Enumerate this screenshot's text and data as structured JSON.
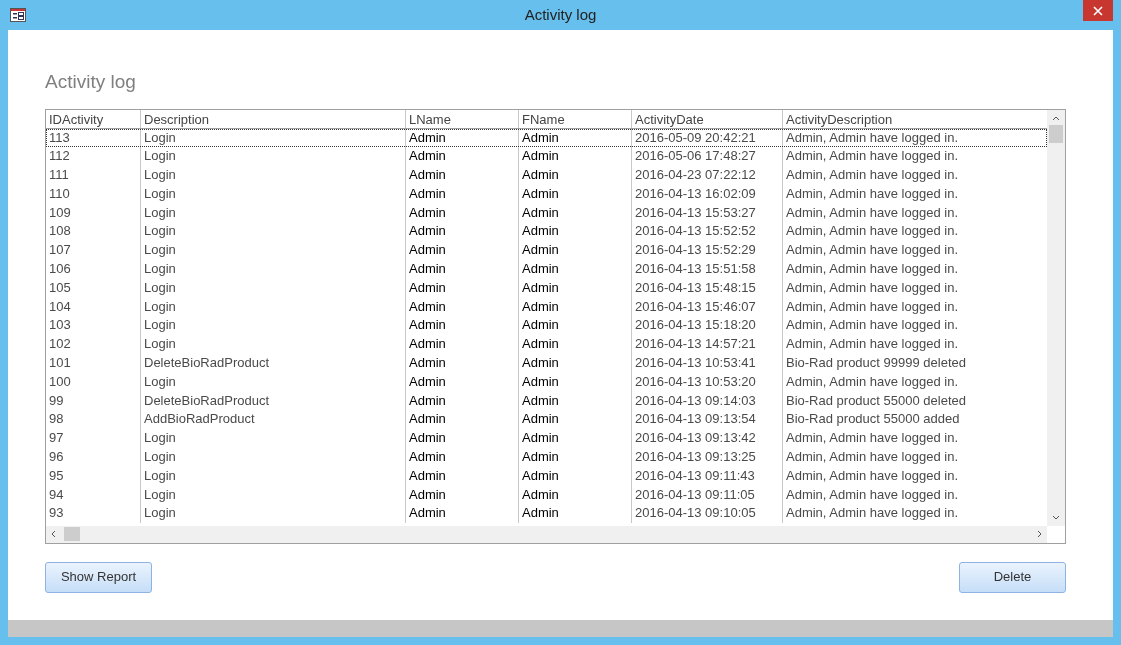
{
  "window": {
    "title": "Activity log"
  },
  "form": {
    "heading": "Activity log"
  },
  "table": {
    "columns": [
      "IDActivity",
      "Description",
      "LName",
      "FName",
      "ActivityDate",
      "ActivityDescription"
    ],
    "rows": [
      {
        "cells": [
          "113",
          "Login",
          "Admin",
          "Admin",
          "2016-05-09 20:42:21",
          "Admin, Admin have logged in."
        ],
        "selected": true
      },
      {
        "cells": [
          "112",
          "Login",
          "Admin",
          "Admin",
          "2016-05-06 17:48:27",
          "Admin, Admin have logged in."
        ],
        "selected": false
      },
      {
        "cells": [
          "111",
          "Login",
          "Admin",
          "Admin",
          "2016-04-23 07:22:12",
          "Admin, Admin have logged in."
        ],
        "selected": false
      },
      {
        "cells": [
          "110",
          "Login",
          "Admin",
          "Admin",
          "2016-04-13 16:02:09",
          "Admin, Admin have logged in."
        ],
        "selected": false
      },
      {
        "cells": [
          "109",
          "Login",
          "Admin",
          "Admin",
          "2016-04-13 15:53:27",
          "Admin, Admin have logged in."
        ],
        "selected": false
      },
      {
        "cells": [
          "108",
          "Login",
          "Admin",
          "Admin",
          "2016-04-13 15:52:52",
          "Admin, Admin have logged in."
        ],
        "selected": false
      },
      {
        "cells": [
          "107",
          "Login",
          "Admin",
          "Admin",
          "2016-04-13 15:52:29",
          "Admin, Admin have logged in."
        ],
        "selected": false
      },
      {
        "cells": [
          "106",
          "Login",
          "Admin",
          "Admin",
          "2016-04-13 15:51:58",
          "Admin, Admin have logged in."
        ],
        "selected": false
      },
      {
        "cells": [
          "105",
          "Login",
          "Admin",
          "Admin",
          "2016-04-13 15:48:15",
          "Admin, Admin have logged in."
        ],
        "selected": false
      },
      {
        "cells": [
          "104",
          "Login",
          "Admin",
          "Admin",
          "2016-04-13 15:46:07",
          "Admin, Admin have logged in."
        ],
        "selected": false
      },
      {
        "cells": [
          "103",
          "Login",
          "Admin",
          "Admin",
          "2016-04-13 15:18:20",
          "Admin, Admin have logged in."
        ],
        "selected": false
      },
      {
        "cells": [
          "102",
          "Login",
          "Admin",
          "Admin",
          "2016-04-13 14:57:21",
          "Admin, Admin have logged in."
        ],
        "selected": false
      },
      {
        "cells": [
          "101",
          "DeleteBioRadProduct",
          "Admin",
          "Admin",
          "2016-04-13 10:53:41",
          "Bio-Rad product 99999 deleted"
        ],
        "selected": false
      },
      {
        "cells": [
          "100",
          "Login",
          "Admin",
          "Admin",
          "2016-04-13 10:53:20",
          "Admin, Admin have logged in."
        ],
        "selected": false
      },
      {
        "cells": [
          "99",
          "DeleteBioRadProduct",
          "Admin",
          "Admin",
          "2016-04-13 09:14:03",
          "Bio-Rad product 55000 deleted"
        ],
        "selected": false
      },
      {
        "cells": [
          "98",
          "AddBioRadProduct",
          "Admin",
          "Admin",
          "2016-04-13 09:13:54",
          "Bio-Rad product 55000 added"
        ],
        "selected": false
      },
      {
        "cells": [
          "97",
          "Login",
          "Admin",
          "Admin",
          "2016-04-13 09:13:42",
          "Admin, Admin have logged in."
        ],
        "selected": false
      },
      {
        "cells": [
          "96",
          "Login",
          "Admin",
          "Admin",
          "2016-04-13 09:13:25",
          "Admin, Admin have logged in."
        ],
        "selected": false
      },
      {
        "cells": [
          "95",
          "Login",
          "Admin",
          "Admin",
          "2016-04-13 09:11:43",
          "Admin, Admin have logged in."
        ],
        "selected": false
      },
      {
        "cells": [
          "94",
          "Login",
          "Admin",
          "Admin",
          "2016-04-13 09:11:05",
          "Admin, Admin have logged in."
        ],
        "selected": false
      },
      {
        "cells": [
          "93",
          "Login",
          "Admin",
          "Admin",
          "2016-04-13 09:10:05",
          "Admin, Admin have logged in."
        ],
        "selected": false
      }
    ]
  },
  "buttons": [
    "Show Report",
    "Delete"
  ]
}
